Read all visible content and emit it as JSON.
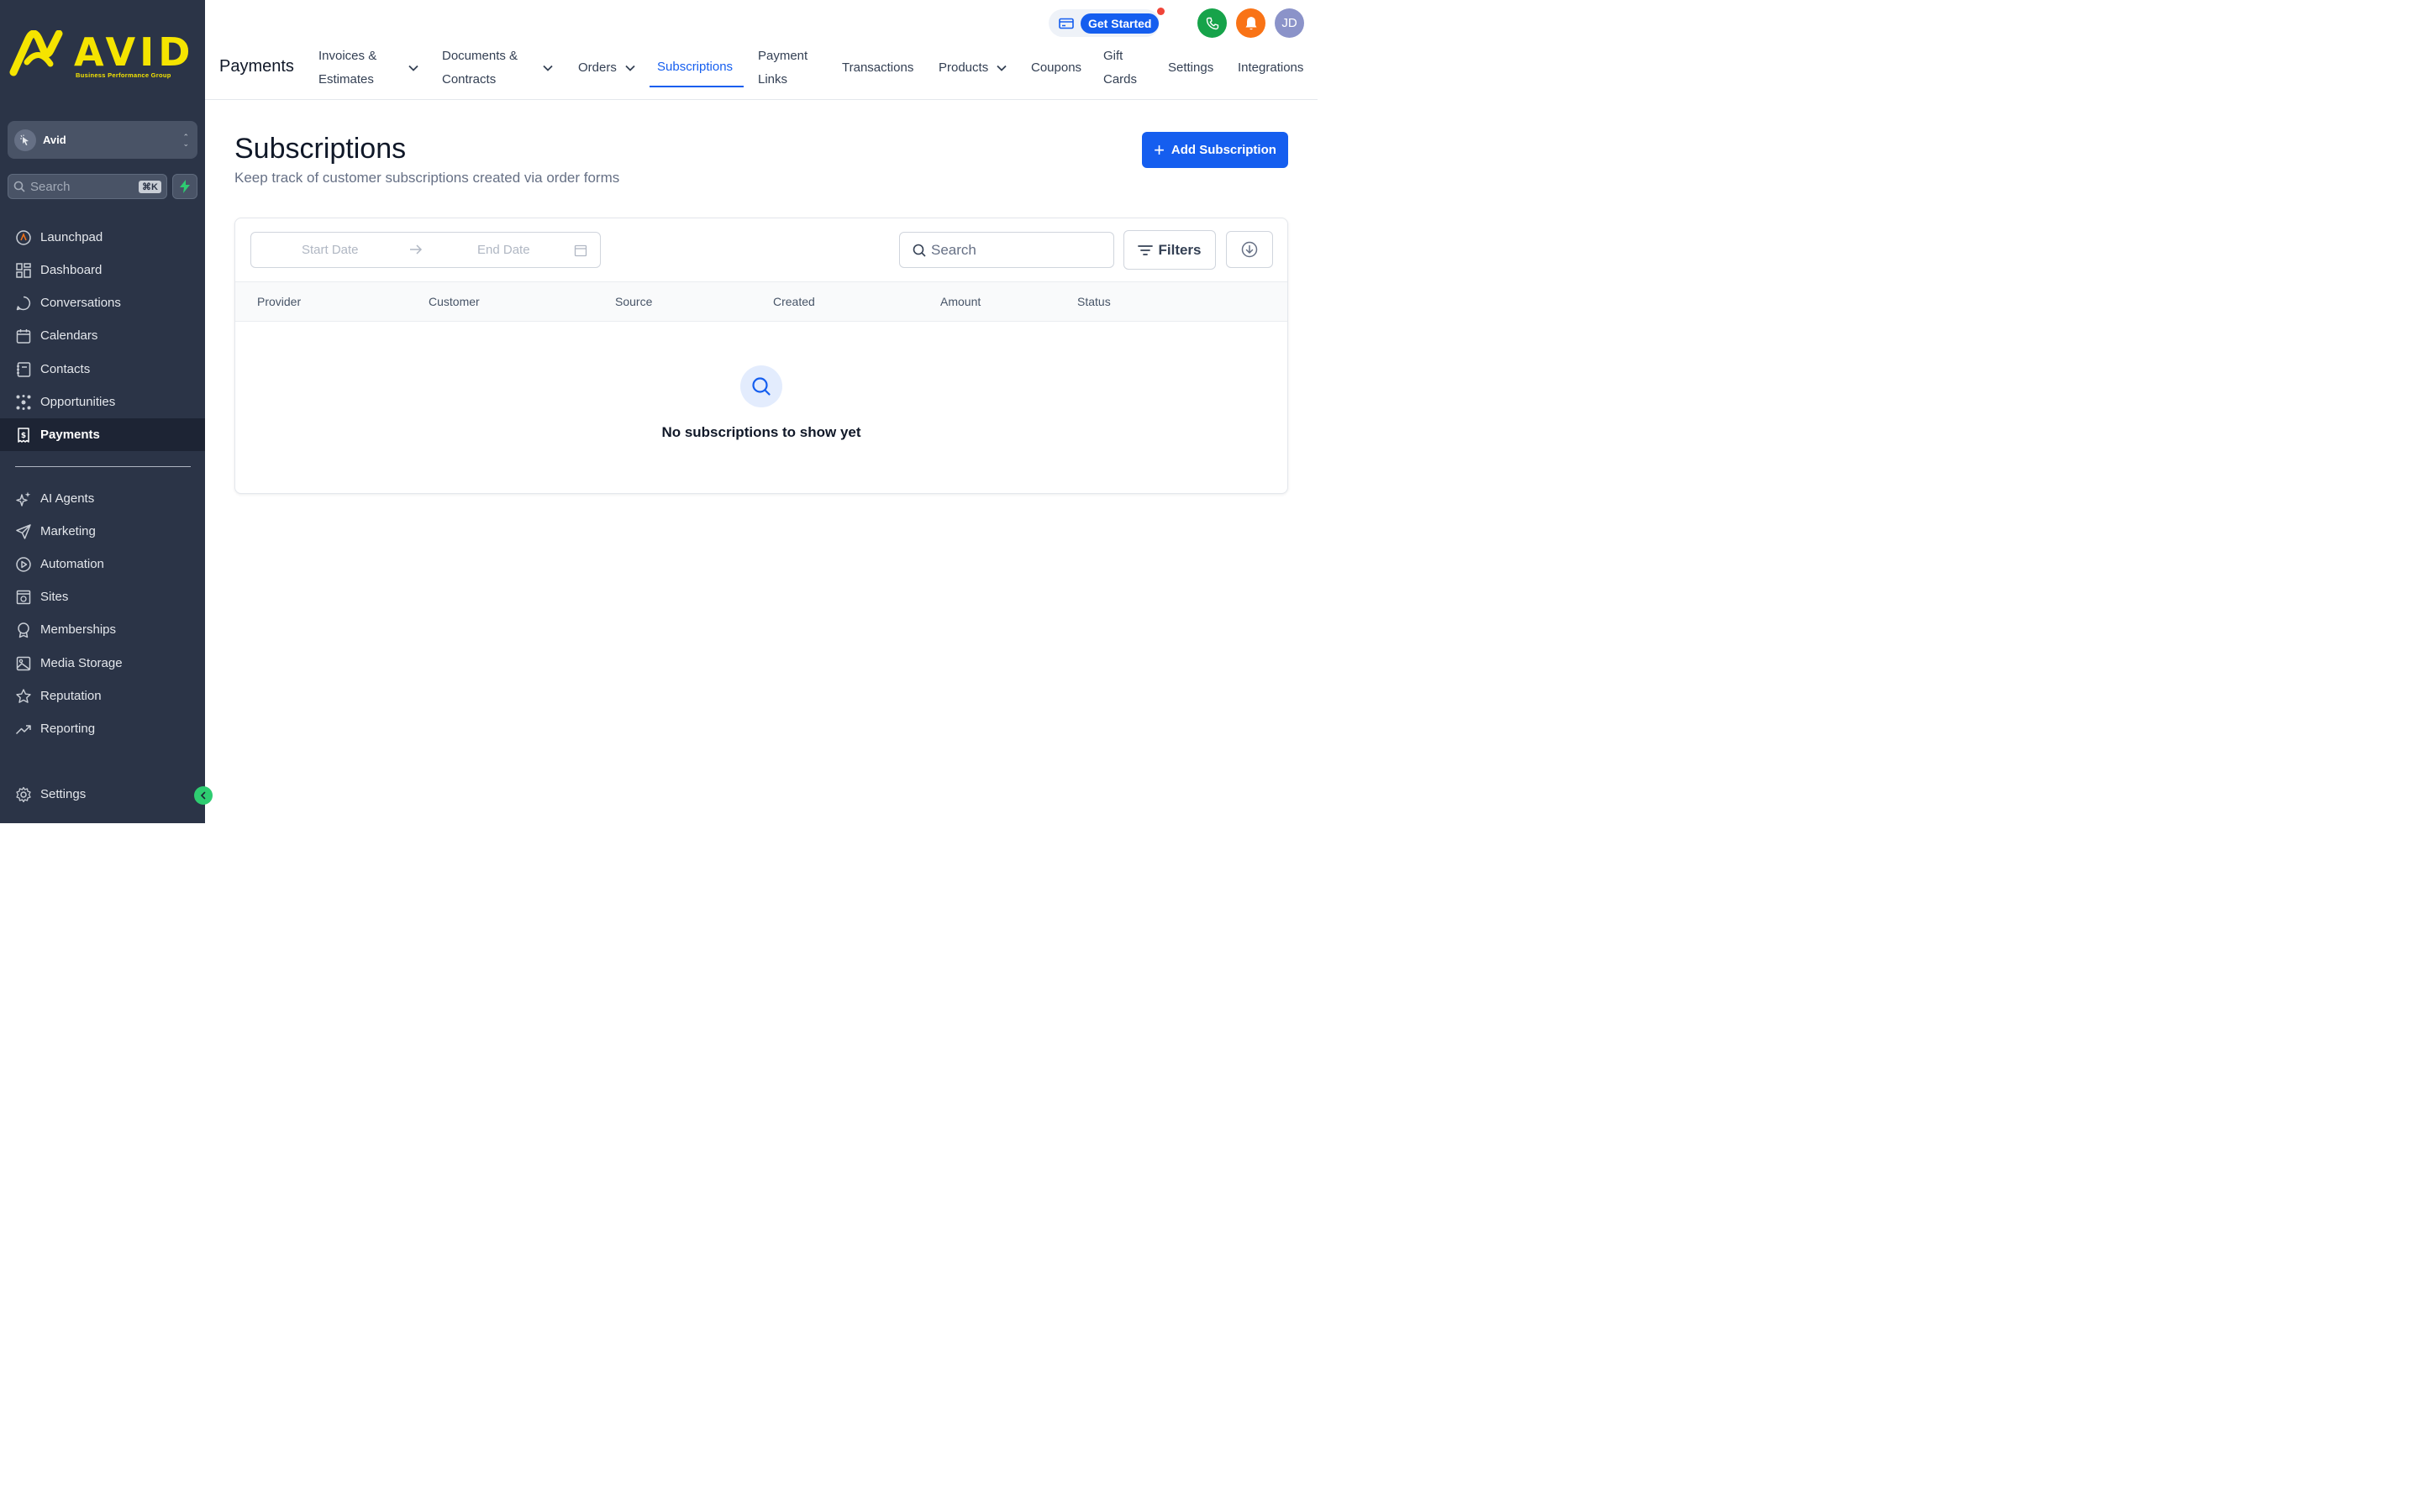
{
  "sidebar": {
    "logo_text": "AVID",
    "logo_subtitle": "Business Performance Group",
    "account_name": "Avid",
    "search_placeholder": "Search",
    "search_shortcut": "⌘K",
    "items": [
      {
        "label": "Launchpad",
        "icon": "launchpad-icon"
      },
      {
        "label": "Dashboard",
        "icon": "dashboard-icon"
      },
      {
        "label": "Conversations",
        "icon": "chat-icon"
      },
      {
        "label": "Calendars",
        "icon": "calendar-icon"
      },
      {
        "label": "Contacts",
        "icon": "contacts-icon"
      },
      {
        "label": "Opportunities",
        "icon": "opportunities-icon"
      },
      {
        "label": "Payments",
        "icon": "payments-icon",
        "active": true
      }
    ],
    "items2": [
      {
        "label": "AI Agents",
        "icon": "sparkle-icon"
      },
      {
        "label": "Marketing",
        "icon": "send-icon"
      },
      {
        "label": "Automation",
        "icon": "automation-icon"
      },
      {
        "label": "Sites",
        "icon": "sites-icon"
      },
      {
        "label": "Memberships",
        "icon": "badge-icon"
      },
      {
        "label": "Media Storage",
        "icon": "image-icon"
      },
      {
        "label": "Reputation",
        "icon": "star-icon"
      },
      {
        "label": "Reporting",
        "icon": "trend-icon"
      }
    ],
    "settings_label": "Settings"
  },
  "header": {
    "title": "Payments",
    "tabs": [
      {
        "line1": "Invoices &",
        "line2": "Estimates",
        "dropdown": true
      },
      {
        "line1": "Documents &",
        "line2": "Contracts",
        "dropdown": true
      },
      {
        "label": "Orders",
        "dropdown": true
      },
      {
        "label": "Subscriptions",
        "active": true
      },
      {
        "line1": "Payment",
        "line2": "Links"
      },
      {
        "label": "Transactions"
      },
      {
        "label": "Products",
        "dropdown": true
      },
      {
        "label": "Coupons"
      },
      {
        "line1": "Gift",
        "line2": "Cards"
      },
      {
        "label": "Settings"
      },
      {
        "label": "Integrations"
      }
    ],
    "get_started_label": "Get Started",
    "avatar_initials": "JD"
  },
  "main": {
    "title": "Subscriptions",
    "subtitle": "Keep track of customer subscriptions created via order forms",
    "add_button_label": "Add Subscription",
    "start_date_placeholder": "Start Date",
    "end_date_placeholder": "End Date",
    "search_placeholder": "Search",
    "filters_label": "Filters",
    "columns": [
      "Provider",
      "Customer",
      "Source",
      "Created",
      "Amount",
      "Status"
    ],
    "empty_message": "No subscriptions to show yet"
  },
  "colors": {
    "sidebar_bg": "#2b3447",
    "accent": "#155eef",
    "logo": "#f5e400",
    "phone_button": "#16a34a",
    "notification_button": "#f97316",
    "avatar": "#8b93c9"
  }
}
